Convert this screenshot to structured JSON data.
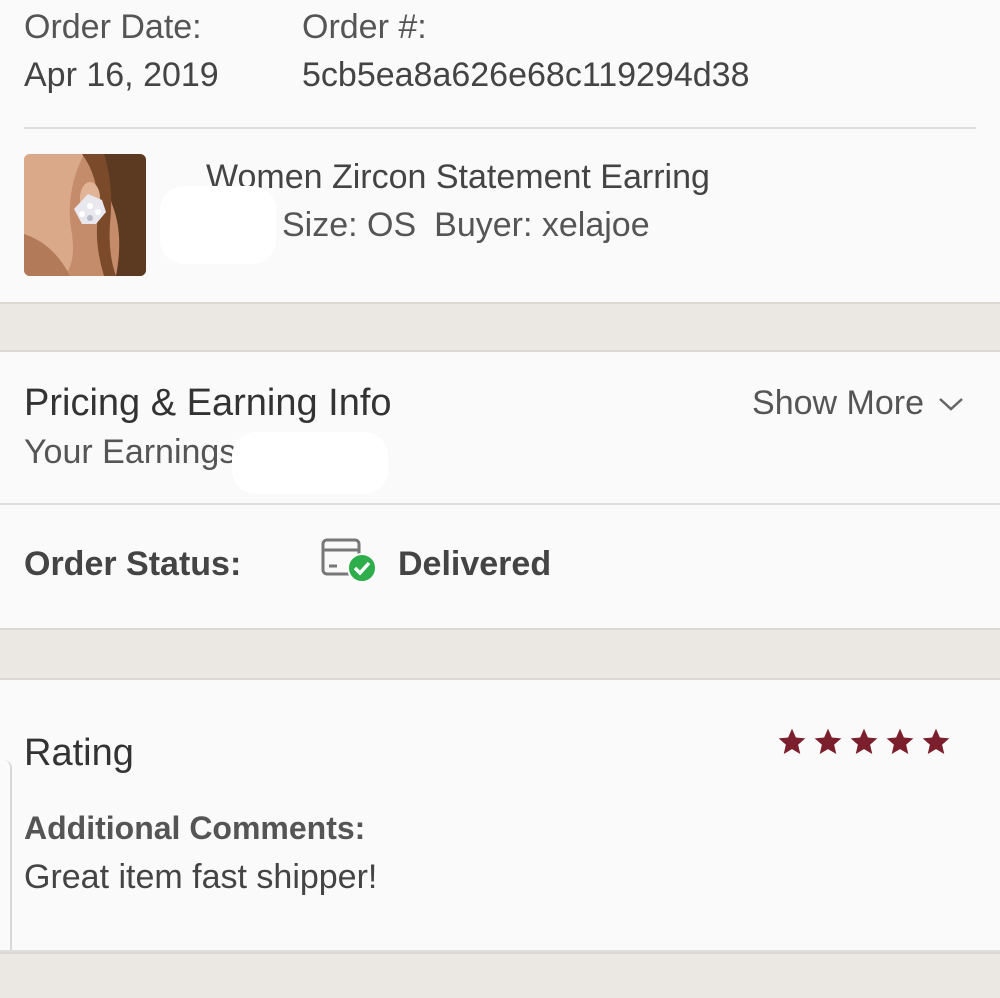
{
  "order": {
    "date_label": "Order Date:",
    "date_value": "Apr 16, 2019",
    "number_label": "Order #:",
    "number_value": "5cb5ea8a626e68c119294d38"
  },
  "item": {
    "title": "Women Zircon Statement Earring",
    "size": "Size: OS",
    "buyer": "Buyer: xelajoe",
    "thumbnail_icon": "earring-photo"
  },
  "pricing": {
    "title": "Pricing & Earning Info",
    "earnings_label": "Your Earnings",
    "show_more": "Show More"
  },
  "status": {
    "label": "Order Status:",
    "value": "Delivered",
    "icon": "package-delivered-icon"
  },
  "rating": {
    "title": "Rating",
    "stars": 5,
    "max_stars": 5,
    "star_color": "#7a1f2b",
    "comments_label": "Additional Comments:",
    "comments_text": "Great item fast shipper!"
  },
  "colors": {
    "check_green": "#2eae4a",
    "separator": "#ebe8e4"
  }
}
